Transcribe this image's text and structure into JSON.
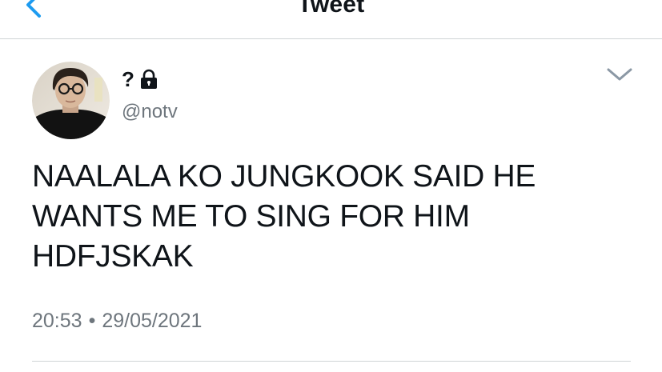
{
  "nav": {
    "title": "Tweet",
    "back_icon": "chevron-left-icon",
    "accent_color": "#1d9bf0"
  },
  "tweet": {
    "display_name": "?",
    "protected_icon": "lock-icon",
    "handle": "@notv",
    "text": "NAALALA KO JUNGKOOK SAID HE\nWANTS ME TO SING FOR HIM\nHDFJSKAK",
    "time": "20:53",
    "separator": "•",
    "date": "29/05/2021",
    "more_icon": "chevron-down-icon"
  },
  "colors": {
    "text": "#0f1419",
    "secondary": "#6e767d",
    "divider": "#cfd3d6"
  }
}
